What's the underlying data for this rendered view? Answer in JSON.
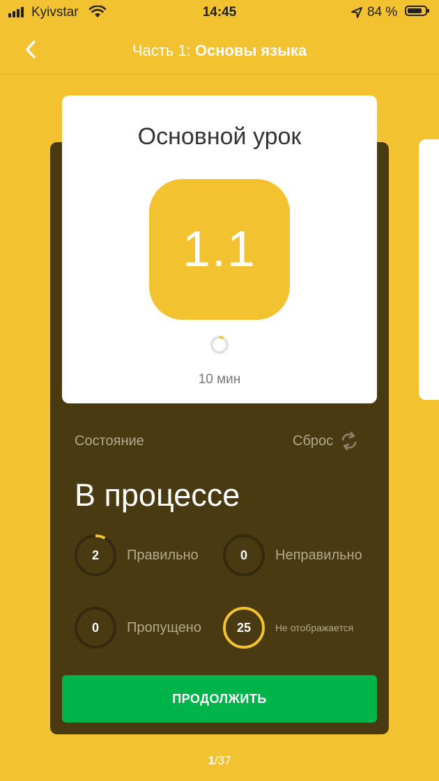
{
  "status_bar": {
    "carrier": "Kyivstar",
    "time": "14:45",
    "battery_percent": "84 %",
    "battery_level": 0.84,
    "icons": [
      "signal-icon",
      "wifi-icon",
      "location-arrow-icon",
      "battery-icon"
    ]
  },
  "nav": {
    "back_icon": "chevron-left-icon",
    "title_prefix": "Часть 1: ",
    "title_main": "Основы языка"
  },
  "lesson": {
    "title": "Основной урок",
    "number": "1.1",
    "duration": "10 мин",
    "progress_fraction": 0.08
  },
  "status": {
    "label": "Состояние",
    "reset_label": "Сброс",
    "reset_icon": "refresh-icon",
    "value": "В процессе"
  },
  "stats": [
    {
      "value": "2",
      "label": "Правильно",
      "fraction": 0.08
    },
    {
      "value": "0",
      "label": "Неправильно",
      "fraction": 0
    },
    {
      "value": "0",
      "label": "Пропущено",
      "fraction": 0
    },
    {
      "value": "25",
      "label": "Не отображается",
      "fraction": 1
    }
  ],
  "continue_button": "ПРОДОЛЖИТЬ",
  "pager": {
    "current": "1",
    "total": "/37"
  },
  "colors": {
    "background": "#F2C230",
    "card_dark": "#4A3A12",
    "accent_green": "#00B44A",
    "ring_yellow": "#F2C230"
  }
}
